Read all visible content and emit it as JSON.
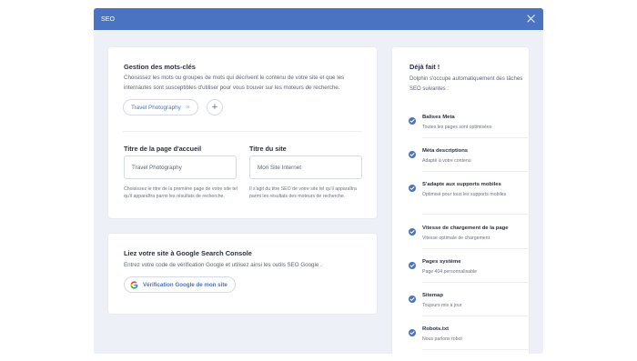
{
  "modal": {
    "title": "SEO"
  },
  "keywords": {
    "title": "Gestion des mots-clés",
    "description": "Choisissez les mots ou groupes de mots qui décrivent le contenu de votre site et que les internautes sont susceptibles d'utiliser pour vous trouver sur les moteurs de recherche.",
    "tag": "Travel Photography",
    "tag_remove": "×",
    "add_symbol": "+"
  },
  "homepage_title": {
    "label": "Titre de la page d'accueil",
    "value": "Travel Photography",
    "help": "Choisissez le titre de la première page de votre site tel qu'il apparaîtra parmi les résultats de recherche."
  },
  "site_title": {
    "label": "Titre du site",
    "value": "Mon Site Internet",
    "help": "Il s'agit du titre SEO de votre site tel qu'il apparaîtra parmi les résultats des moteurs de recherche."
  },
  "gsc": {
    "title": "Liez votre site à Google Search Console",
    "description": "Entrez votre code de vérification Google et utilisez ainsi les outils SEO Google .",
    "button": "Vérification Google de mon site"
  },
  "done": {
    "title": "Déjà fait !",
    "description": "Dolphin s'occupe automatiquement des tâches SEO suivantes :",
    "items": [
      {
        "title": "Balises Meta",
        "sub": "Toutes les pages sont optimisées"
      },
      {
        "title": "Méta descriptions",
        "sub": "Adapté à votre contenu"
      },
      {
        "title": "S'adapte aux supports mobiles",
        "sub": "Optimisé pour tous les supports mobiles"
      },
      {
        "title": "Vitesse de chargement de la page",
        "sub": "Vitesse optimale de chargement"
      },
      {
        "title": "Pages système",
        "sub": "Page 404 personnalisable"
      },
      {
        "title": "Sitemap",
        "sub": "Toujours mis à jour"
      },
      {
        "title": "Robots.txt",
        "sub": "Nous parlons robot"
      }
    ]
  },
  "colors": {
    "accent": "#4a73c2",
    "background": "#eef0f7"
  }
}
